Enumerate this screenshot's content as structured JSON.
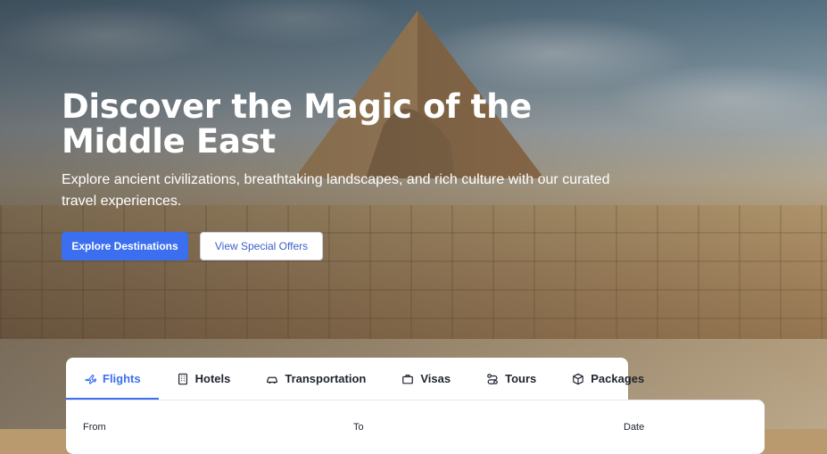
{
  "hero": {
    "title": "Discover the Magic of the Middle East",
    "subtitle": "Explore ancient civilizations, breathtaking landscapes, and rich culture with our curated travel experiences.",
    "primary_cta": "Explore Destinations",
    "secondary_cta": "View Special Offers"
  },
  "booking": {
    "tabs": [
      {
        "label": "Flights",
        "icon": "plane-icon",
        "active": true
      },
      {
        "label": "Hotels",
        "icon": "building-icon"
      },
      {
        "label": "Transportation",
        "icon": "car-icon"
      },
      {
        "label": "Visas",
        "icon": "briefcase-icon"
      },
      {
        "label": "Tours",
        "icon": "route-icon"
      },
      {
        "label": "Packages",
        "icon": "package-icon"
      }
    ],
    "fields": {
      "from_label": "From",
      "to_label": "To",
      "date_label": "Date"
    }
  },
  "colors": {
    "accent": "#3b6ff0",
    "text_dark": "#1f2430",
    "white": "#ffffff"
  }
}
